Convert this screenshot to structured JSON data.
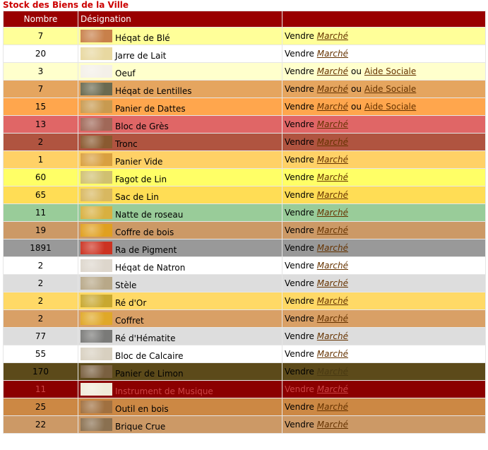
{
  "page_title": "Stock des Biens de la Ville",
  "headers": [
    "Nombre",
    "Désignation",
    ""
  ],
  "labels": {
    "sell": "Vendre",
    "market": "Marché",
    "or": "ou",
    "aid": "Aide Sociale"
  },
  "rows": [
    {
      "qty": "7",
      "name": "Héqat de Blé",
      "icon": "wheat-icon",
      "bg": "#ffff99",
      "fg": "#000000",
      "link": "#663300",
      "aid": false,
      "thumb": "#c8804a"
    },
    {
      "qty": "20",
      "name": "Jarre de Lait",
      "icon": "milk-jar-icon",
      "bg": "#ffffff",
      "fg": "#000000",
      "link": "#663300",
      "aid": false,
      "thumb": "#e8d8a0"
    },
    {
      "qty": "3",
      "name": "Oeuf",
      "icon": "egg-icon",
      "bg": "#ffffcc",
      "fg": "#000000",
      "link": "#663300",
      "aid": true,
      "thumb": "#f4f0e8"
    },
    {
      "qty": "7",
      "name": "Héqat de Lentilles",
      "icon": "lentils-icon",
      "bg": "#e5a55f",
      "fg": "#000000",
      "link": "#663300",
      "aid": true,
      "thumb": "#6a6a50"
    },
    {
      "qty": "15",
      "name": "Panier de Dattes",
      "icon": "dates-basket-icon",
      "bg": "#ffa64d",
      "fg": "#000000",
      "link": "#663300",
      "aid": true,
      "thumb": "#c89a50"
    },
    {
      "qty": "13",
      "name": "Bloc de Grès",
      "icon": "sandstone-icon",
      "bg": "#e06666",
      "fg": "#000000",
      "link": "#663300",
      "aid": false,
      "thumb": "#a06858"
    },
    {
      "qty": "2",
      "name": "Tronc",
      "icon": "log-icon",
      "bg": "#b05440",
      "fg": "#000000",
      "link": "#663300",
      "aid": false,
      "thumb": "#8a5a30"
    },
    {
      "qty": "1",
      "name": "Panier Vide",
      "icon": "empty-basket-icon",
      "bg": "#ffd166",
      "fg": "#000000",
      "link": "#663300",
      "aid": false,
      "thumb": "#d9a040"
    },
    {
      "qty": "60",
      "name": "Fagot de Lin",
      "icon": "flax-bundle-icon",
      "bg": "#ffff66",
      "fg": "#000000",
      "link": "#663300",
      "aid": false,
      "thumb": "#d0c070"
    },
    {
      "qty": "65",
      "name": "Sac de Lin",
      "icon": "flax-sack-icon",
      "bg": "#ffdd55",
      "fg": "#000000",
      "link": "#663300",
      "aid": false,
      "thumb": "#d8b860"
    },
    {
      "qty": "11",
      "name": "Natte de roseau",
      "icon": "reed-mat-icon",
      "bg": "#99cc99",
      "fg": "#000000",
      "link": "#663300",
      "aid": false,
      "thumb": "#d8b040"
    },
    {
      "qty": "19",
      "name": "Coffre de bois",
      "icon": "wooden-chest-icon",
      "bg": "#cc9966",
      "fg": "#000000",
      "link": "#663300",
      "aid": false,
      "thumb": "#e0a020"
    },
    {
      "qty": "1891",
      "name": "Ra de Pigment",
      "icon": "pigment-icon",
      "bg": "#999999",
      "fg": "#000000",
      "link": "#663300",
      "aid": false,
      "thumb": "#cc3322"
    },
    {
      "qty": "2",
      "name": "Héqat de Natron",
      "icon": "natron-icon",
      "bg": "#ffffff",
      "fg": "#000000",
      "link": "#663300",
      "aid": false,
      "thumb": "#ddd6cc"
    },
    {
      "qty": "2",
      "name": "Stèle",
      "icon": "stele-icon",
      "bg": "#dddddd",
      "fg": "#000000",
      "link": "#663300",
      "aid": false,
      "thumb": "#b8a888"
    },
    {
      "qty": "2",
      "name": "Ré d'Or",
      "icon": "gold-icon",
      "bg": "#ffd966",
      "fg": "#000000",
      "link": "#663300",
      "aid": false,
      "thumb": "#c8a830"
    },
    {
      "qty": "2",
      "name": "Coffret",
      "icon": "small-chest-icon",
      "bg": "#d9a066",
      "fg": "#000000",
      "link": "#663300",
      "aid": false,
      "thumb": "#e0a828"
    },
    {
      "qty": "77",
      "name": "Ré d'Hématite",
      "icon": "hematite-icon",
      "bg": "#dddddd",
      "fg": "#000000",
      "link": "#663300",
      "aid": false,
      "thumb": "#7a7a78"
    },
    {
      "qty": "55",
      "name": "Bloc de Calcaire",
      "icon": "limestone-icon",
      "bg": "#ffffff",
      "fg": "#000000",
      "link": "#663300",
      "aid": false,
      "thumb": "#d8d0c0"
    },
    {
      "qty": "170",
      "name": "Panier de Limon",
      "icon": "silt-basket-icon",
      "bg": "#5c4a1a",
      "fg": "#000000",
      "link": "#4a3a12",
      "aid": false,
      "thumb": "#7a6040"
    },
    {
      "qty": "11",
      "name": "Instrument de Musique",
      "icon": "instrument-icon",
      "bg": "#8b0000",
      "fg": "#cc4444",
      "link": "#cc4444",
      "aid": false,
      "thumb": "#f0ead8"
    },
    {
      "qty": "25",
      "name": "Outil en bois",
      "icon": "wood-tool-icon",
      "bg": "#cc8844",
      "fg": "#000000",
      "link": "#663300",
      "aid": false,
      "thumb": "#a07040"
    },
    {
      "qty": "22",
      "name": "Brique Crue",
      "icon": "mud-brick-icon",
      "bg": "#cc9966",
      "fg": "#000000",
      "link": "#663300",
      "aid": false,
      "thumb": "#8a7050"
    }
  ]
}
